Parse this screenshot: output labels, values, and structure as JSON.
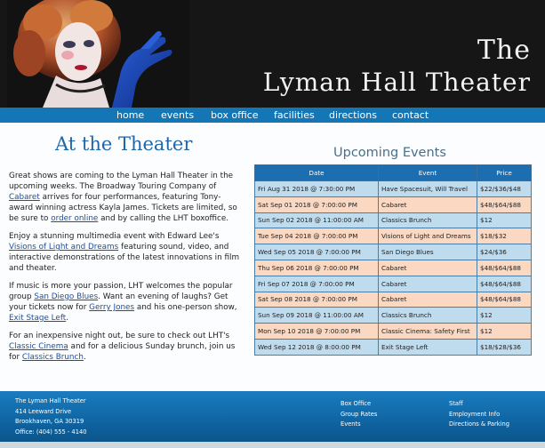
{
  "header": {
    "title_line1": "The",
    "title_line2": "Lyman Hall Theater",
    "photo_alt": "Theatrical performer with red hair and blue gloves"
  },
  "nav": {
    "items": [
      "home",
      "events",
      "box office",
      "facilities",
      "directions",
      "contact"
    ]
  },
  "main": {
    "heading": "At the Theater",
    "p1": {
      "t1": "Great shows are coming to the Lyman Hall Theater in the upcoming weeks. The Broadway Touring Company of ",
      "link1": "Cabaret",
      "t2": " arrives for four performances, featuring Tony-award winning actress Kayla James. Tickets are limited, so be sure to ",
      "link2": "order online",
      "t3": " and by calling the LHT boxoffice."
    },
    "p2": {
      "t1": "Enjoy a stunning multimedia event with Edward Lee's ",
      "link1": "Visions of Light and Dreams",
      "t2": " featuring sound, video, and interactive demonstrations of the latest innovations in film and theater."
    },
    "p3": {
      "t1": "If music is more your passion, LHT welcomes the popular group ",
      "link1": "San Diego Blues",
      "t2": ". Want an evening of laughs? Get your tickets now for ",
      "link2": "Gerry Jones",
      "t3": " and his one-person show, ",
      "link3": "Exit Stage Left",
      "t4": "."
    },
    "p4": {
      "t1": "For an inexpensive night out, be sure to check out LHT's ",
      "link1": "Classic Cinema",
      "t2": " and for a delicious Sunday brunch, join us for ",
      "link2": "Classics Brunch",
      "t3": "."
    }
  },
  "events": {
    "title": "Upcoming Events",
    "columns": [
      "Date",
      "Event",
      "Price"
    ],
    "rows": [
      {
        "date": "Fri Aug 31 2018 @ 7:30:00 PM",
        "event": "Have Spacesuit, Will Travel",
        "price": "$22/$36/$48"
      },
      {
        "date": "Sat Sep 01 2018 @ 7:00:00 PM",
        "event": "Cabaret",
        "price": "$48/$64/$88"
      },
      {
        "date": "Sun Sep 02 2018 @ 11:00:00 AM",
        "event": "Classics Brunch",
        "price": "$12"
      },
      {
        "date": "Tue Sep 04 2018 @ 7:00:00 PM",
        "event": "Visions of Light and Dreams",
        "price": "$18/$32"
      },
      {
        "date": "Wed Sep 05 2018 @ 7:00:00 PM",
        "event": "San Diego Blues",
        "price": "$24/$36"
      },
      {
        "date": "Thu Sep 06 2018 @ 7:00:00 PM",
        "event": "Cabaret",
        "price": "$48/$64/$88"
      },
      {
        "date": "Fri Sep 07 2018 @ 7:00:00 PM",
        "event": "Cabaret",
        "price": "$48/$64/$88"
      },
      {
        "date": "Sat Sep 08 2018 @ 7:00:00 PM",
        "event": "Cabaret",
        "price": "$48/$64/$88"
      },
      {
        "date": "Sun Sep 09 2018 @ 11:00:00 AM",
        "event": "Classics Brunch",
        "price": "$12"
      },
      {
        "date": "Mon Sep 10 2018 @ 7:00:00 PM",
        "event": "Classic Cinema: Safety First",
        "price": "$12"
      },
      {
        "date": "Wed Sep 12 2018 @ 8:00:00 PM",
        "event": "Exit Stage Left",
        "price": "$18/$28/$36"
      }
    ]
  },
  "footer": {
    "address": [
      "The Lyman Hall Theater",
      "414 Leeward Drive",
      "Brookhaven, GA 30319",
      "Office: (404) 555 - 4140"
    ],
    "links_col1": [
      "Box Office",
      "Group Rates",
      "Events"
    ],
    "links_col2": [
      "Staff",
      "Employment Info",
      "Directions & Parking"
    ]
  },
  "colors": {
    "banner_bg": "#161616",
    "nav_bg": "#1476b4",
    "heading": "#2166a8",
    "table_header": "#1d6eb0",
    "row_blue": "#bfdcef",
    "row_peach": "#fad8c1",
    "footer_bg": "#0c5d98"
  }
}
